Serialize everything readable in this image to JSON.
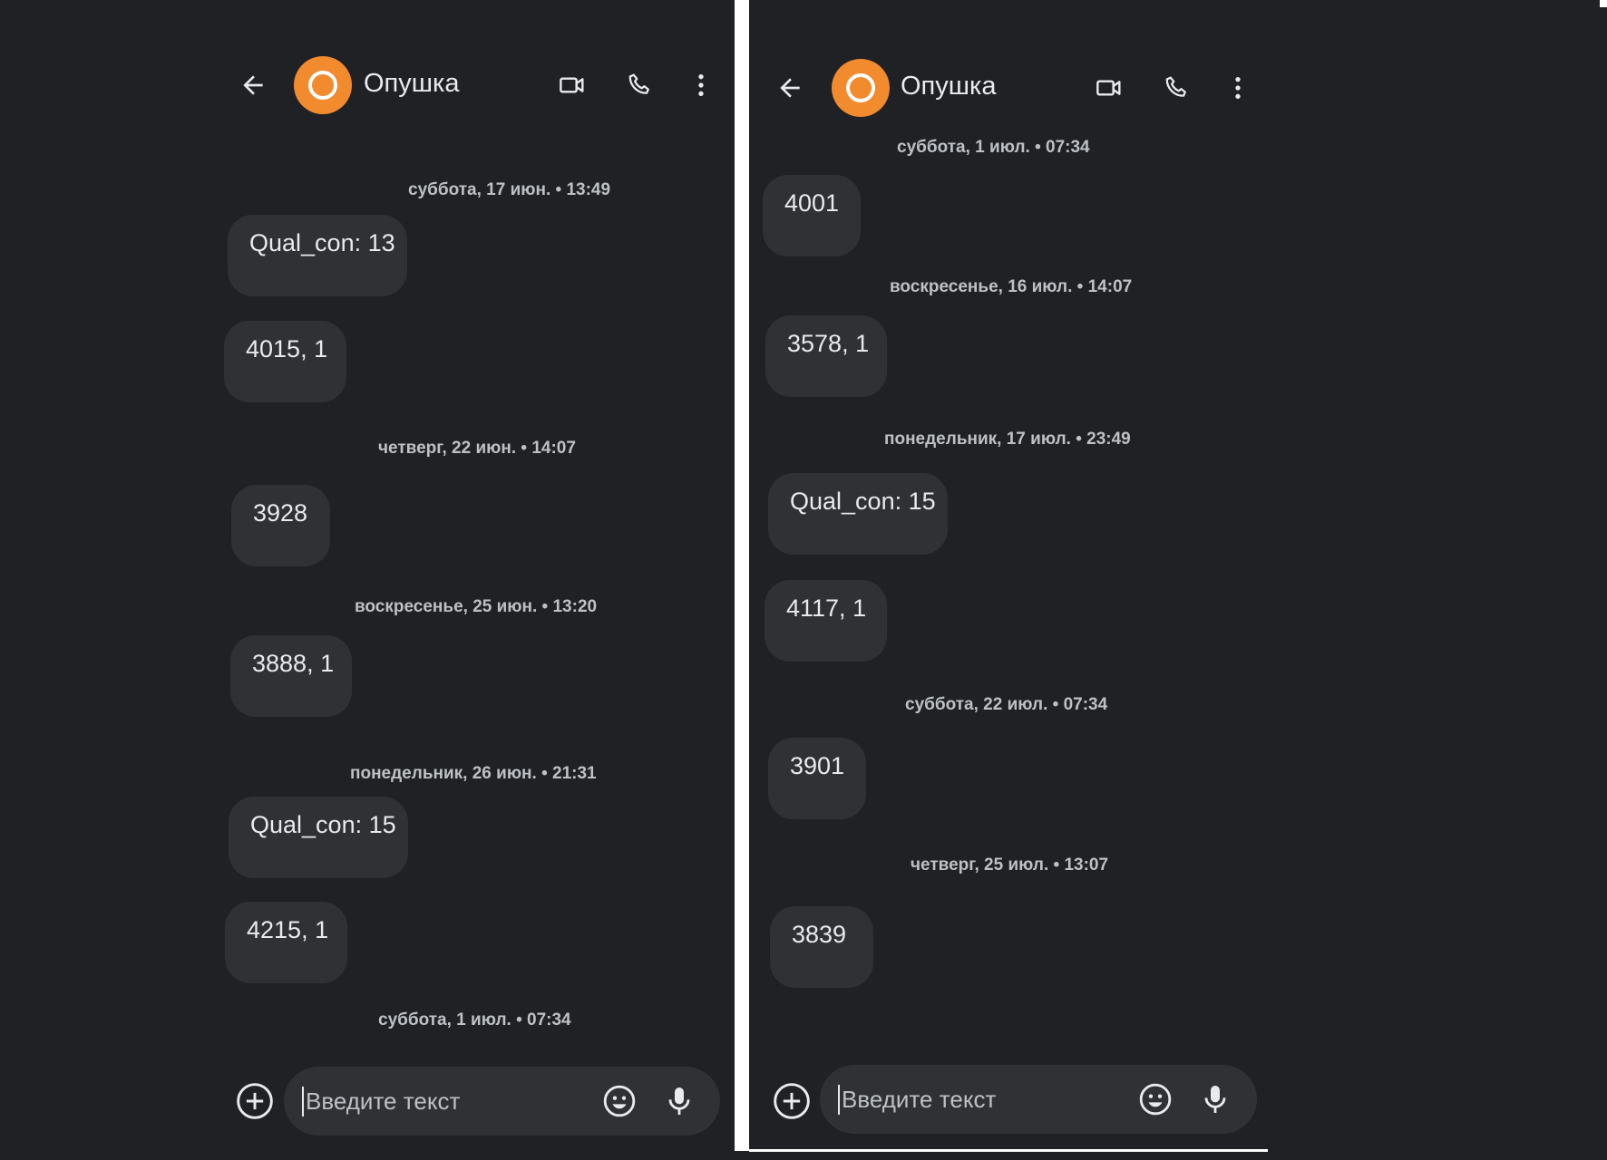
{
  "left": {
    "header": {
      "title": "Опушка",
      "back_icon": "arrow-left-icon",
      "video_icon": "video-call-icon",
      "phone_icon": "phone-icon",
      "more_icon": "more-vert-icon"
    },
    "timestamps": [
      "суббота, 17 июн. • 13:49",
      "четверг, 22 июн. • 14:07",
      "воскресенье, 25 июн. • 13:20",
      "понедельник, 26 июн. • 21:31",
      "суббота, 1 июл. • 07:34"
    ],
    "messages": [
      "Qual_con: 13",
      "4015, 1",
      "3928",
      "3888, 1",
      "Qual_con: 15",
      "4215, 1"
    ],
    "composer": {
      "placeholder": "Введите текст"
    }
  },
  "right": {
    "header": {
      "title": "Опушка"
    },
    "timestamps": [
      "суббота, 1 июл. • 07:34",
      "воскресенье, 16 июл. • 14:07",
      "понедельник, 17 июл. • 23:49",
      "суббота, 22 июл. • 07:34",
      "четверг, 25 июл. • 13:07"
    ],
    "messages": [
      "4001",
      "3578, 1",
      "Qual_con: 15",
      "4117, 1",
      "3901",
      "3839"
    ],
    "composer": {
      "placeholder": "Введите текст"
    }
  },
  "colors": {
    "background": "#202124",
    "bubble": "#303134",
    "avatar": "#f28a2e",
    "text": "#e8eaed"
  }
}
